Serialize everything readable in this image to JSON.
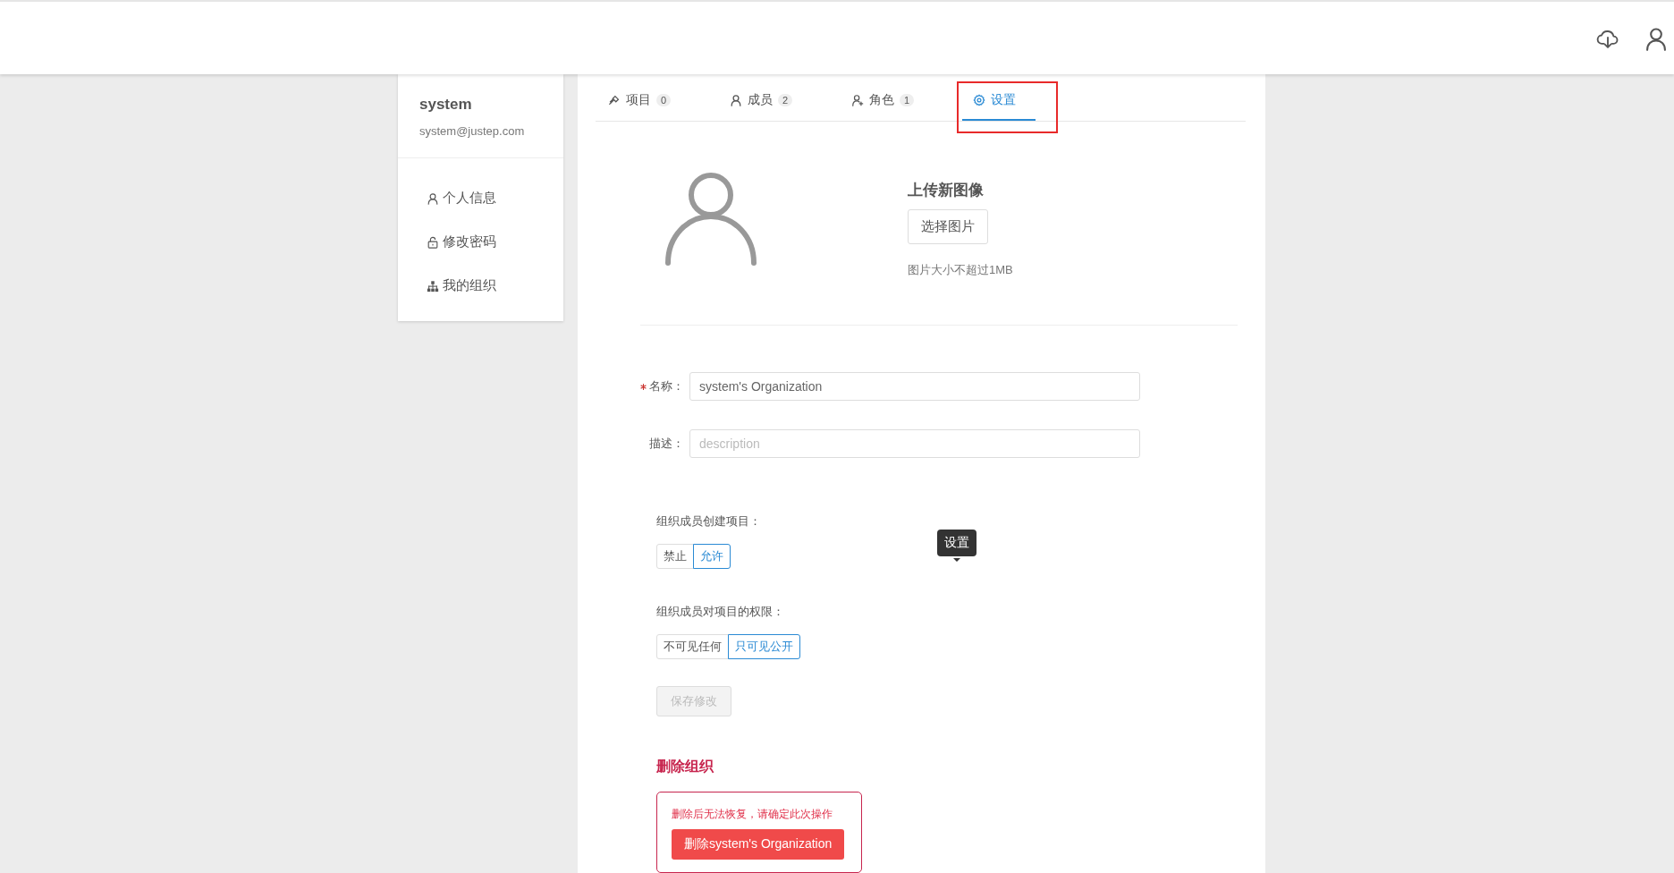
{
  "user": {
    "name": "system",
    "email": "system@justep.com"
  },
  "sidebar": {
    "items": [
      {
        "label": "个人信息",
        "kind": "user"
      },
      {
        "label": "修改密码",
        "kind": "lock"
      },
      {
        "label": "我的组织",
        "kind": "org"
      }
    ]
  },
  "tabs": [
    {
      "label": "项目",
      "count": "0",
      "kind": "project",
      "selected": false
    },
    {
      "label": "成员",
      "count": "2",
      "kind": "member",
      "selected": false
    },
    {
      "label": "角色",
      "count": "1",
      "kind": "role",
      "selected": false
    },
    {
      "label": "设置",
      "kind": "settings",
      "selected": true
    }
  ],
  "upload": {
    "title": "上传新图像",
    "button": "选择图片",
    "hint": "图片大小不超过1MB"
  },
  "form": {
    "fields": [
      {
        "label": "名称：",
        "required": true,
        "value": "system's Organization"
      },
      {
        "label": "描述：",
        "required": false,
        "placeholder": "description"
      }
    ]
  },
  "permissions": [
    {
      "label": "组织成员创建项目：",
      "options": [
        {
          "label": "禁止",
          "selected": false
        },
        {
          "label": "允许",
          "selected": true
        }
      ]
    },
    {
      "label": "组织成员对项目的权限：",
      "options": [
        {
          "label": "不可见任何",
          "selected": false
        },
        {
          "label": "只可见公开",
          "selected": true
        }
      ]
    }
  ],
  "save_button": {
    "label": "保存修改",
    "disabled": true
  },
  "danger_zone": {
    "title": "删除组织",
    "warning": "删除后无法恢复，请确定此次操作",
    "button": "删除system's Organization"
  },
  "tooltip": {
    "text": "设置"
  }
}
